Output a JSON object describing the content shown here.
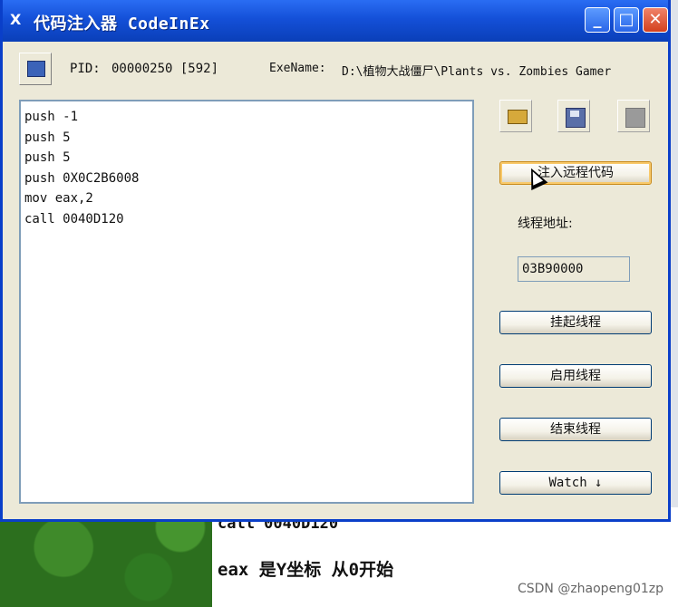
{
  "window": {
    "title": "代码注入器 CodeInEx",
    "title_icon": "X"
  },
  "window_controls": {
    "minimize": "_",
    "maximize": "□",
    "close": "✕"
  },
  "process": {
    "pid_label": "PID:",
    "pid_value": "00000250 [592]",
    "exe_label": "ExeName:",
    "exe_value": "D:\\植物大战僵尸\\Plants vs. Zombies Gamer"
  },
  "editor": {
    "lines": [
      "push -1",
      "push 5",
      "push 5",
      "push 0X0C2B6008",
      "mov eax,2",
      "call 0040D120"
    ]
  },
  "toolbar": {
    "open_icon": "folder-open-icon",
    "save_icon": "save-disk-icon",
    "stop_icon": "stop-icon"
  },
  "actions": {
    "inject": "注入远程代码",
    "thread_address_label": "线程地址:",
    "thread_address_value": "03B90000",
    "suspend": "挂起线程",
    "resume": "启用线程",
    "terminate": "结束线程",
    "watch": "Watch ↓"
  },
  "background": {
    "code_line": "call 0040D120",
    "note": "eax 是Y坐标 从0开始",
    "watermark": "CSDN @zhaopeng01zp"
  },
  "colors": {
    "titlebar": "#1450d8",
    "window_bg": "#ece9d8",
    "close_button": "#d3401e"
  }
}
